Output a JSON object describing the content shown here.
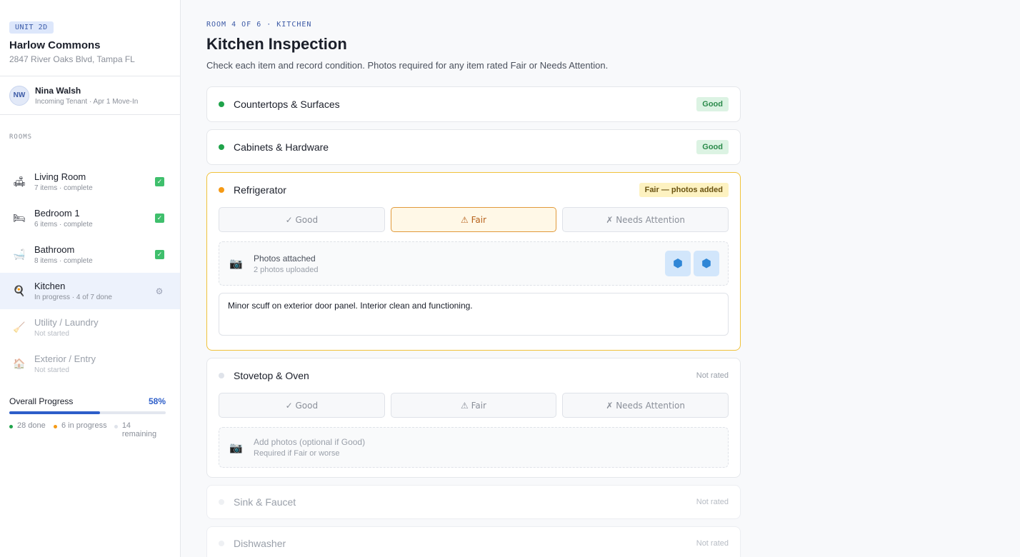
{
  "unit": {
    "badge": "UNIT 2D",
    "property_name": "Harlow Commons",
    "address": "2847 River Oaks Blvd, Tampa FL"
  },
  "tenant": {
    "initials": "NW",
    "name": "Nina Walsh",
    "role": "Incoming Tenant · Apr 1 Move-In"
  },
  "rooms_label": "ROOMS",
  "rooms": [
    {
      "icon": "🛋",
      "name": "Living Room",
      "sub": "7 items · complete",
      "status": "complete"
    },
    {
      "icon": "🛏",
      "name": "Bedroom 1",
      "sub": "6 items · complete",
      "status": "complete"
    },
    {
      "icon": "🛁",
      "name": "Bathroom",
      "sub": "8 items · complete",
      "status": "complete"
    },
    {
      "icon": "🍳",
      "name": "Kitchen",
      "sub": "In progress · 4 of 7 done",
      "status": "in-progress"
    },
    {
      "icon": "🧹",
      "name": "Utility / Laundry",
      "sub": "Not started",
      "status": "not-started"
    },
    {
      "icon": "🏠",
      "name": "Exterior / Entry",
      "sub": "Not started",
      "status": "not-started"
    }
  ],
  "progress": {
    "label": "Overall Progress",
    "percent_label": "58%",
    "percent": 58,
    "done": "28 done",
    "in_progress": "6 in progress",
    "remaining": "14 remaining"
  },
  "header": {
    "breadcrumb": "ROOM 4 OF 6 · KITCHEN",
    "title": "Kitchen Inspection",
    "description": "Check each item and record condition. Photos required for any item rated Fair or Needs Attention."
  },
  "rating_labels": {
    "good": "✓ Good",
    "fair": "⚠ Fair",
    "attention": "✗ Needs Attention"
  },
  "items": [
    {
      "name": "Countertops & Surfaces",
      "badge": "Good"
    },
    {
      "name": "Cabinets & Hardware",
      "badge": "Good"
    },
    {
      "name": "Refrigerator",
      "badge": "Fair — photos added",
      "photo_title": "Photos attached",
      "photo_sub": "2 photos uploaded",
      "notes": "Minor scuff on exterior door panel. Interior clean and functioning."
    },
    {
      "name": "Stovetop & Oven",
      "badge": "Not rated",
      "photo_title": "Add photos (optional if Good)",
      "photo_sub": "Required if Fair or worse"
    },
    {
      "name": "Sink & Faucet",
      "badge": "Not rated"
    },
    {
      "name": "Dishwasher",
      "badge": "Not rated"
    }
  ],
  "colors": {
    "accent": "#2d5ec9",
    "good": "#1fa34a",
    "fair": "#f59a16",
    "unrated": "#dfe3ea"
  }
}
